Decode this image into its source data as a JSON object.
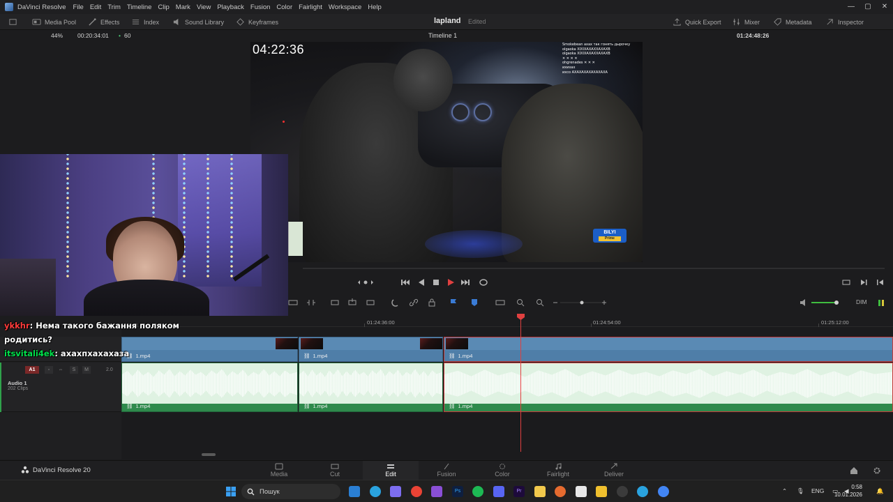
{
  "app": {
    "name": "DaVinci Resolve",
    "menu": [
      "File",
      "Edit",
      "Trim",
      "Timeline",
      "Clip",
      "Mark",
      "View",
      "Playback",
      "Fusion",
      "Color",
      "Fairlight",
      "Workspace",
      "Help"
    ]
  },
  "toolbar": {
    "media_pool": "Media Pool",
    "effects": "Effects",
    "index": "Index",
    "sound_library": "Sound Library",
    "keyframes": "Keyframes",
    "project_name": "lapland",
    "project_status": "Edited",
    "quick_export": "Quick Export",
    "mixer": "Mixer",
    "metadata": "Metadata",
    "inspector": "Inspector"
  },
  "viewer": {
    "zoom": "44%",
    "source_timecode": "00:20:34:01",
    "fps": "60",
    "timeline_name": "Timeline 1",
    "record_timecode": "01:24:48:26"
  },
  "video_overlay": {
    "stream_timer": "04:22:36",
    "chat_lines": [
      "Smokebean ахах так гонять дырочку",
      "olgaoka XIXIXAXAXXAXAXB",
      "olgaoka XIXIXAXAXXAXAXB",
      "✕ ✕ ✕ ✕",
      "ohgrenades ✕ ✕ ✕",
      "ихихах",
      "ихсо АХАХАХАХАХАХАХА"
    ],
    "sticker_title": "BILYI",
    "sticker_sub": "Prime"
  },
  "chat": [
    {
      "user": "ykkhr",
      "text": ": Нема такого бажання поляком родитись?"
    },
    {
      "user": "itsvitali4ek",
      "text": ": ахахпхахахаза"
    }
  ],
  "timeline_ruler": [
    "01:24:36:00",
    "01:24:54:00",
    "01:25:12:00"
  ],
  "tracks": {
    "a1_badge": "A1",
    "audio_name": "Audio 1",
    "audio_clips": "202 Clips",
    "audio_level": "2.0",
    "s_btn": "S",
    "m_btn": "M",
    "clip_name": "1.mp4"
  },
  "transport": {
    "dim": "DIM"
  },
  "pages": [
    "Media",
    "Cut",
    "Edit",
    "Fusion",
    "Color",
    "Fairlight",
    "Deliver"
  ],
  "active_page": "Edit",
  "brand_version": "DaVinci Resolve 20",
  "taskbar": {
    "search_placeholder": "Пошук",
    "lang": "ENG",
    "time": "0:58",
    "date": "10.01.2026"
  },
  "colors": {
    "accent_red": "#e04040",
    "video_clip": "#4f7ea8",
    "audio_clip": "#2e8a4c",
    "chat_user1": "#ff3b3b",
    "chat_user2": "#00e04b"
  }
}
